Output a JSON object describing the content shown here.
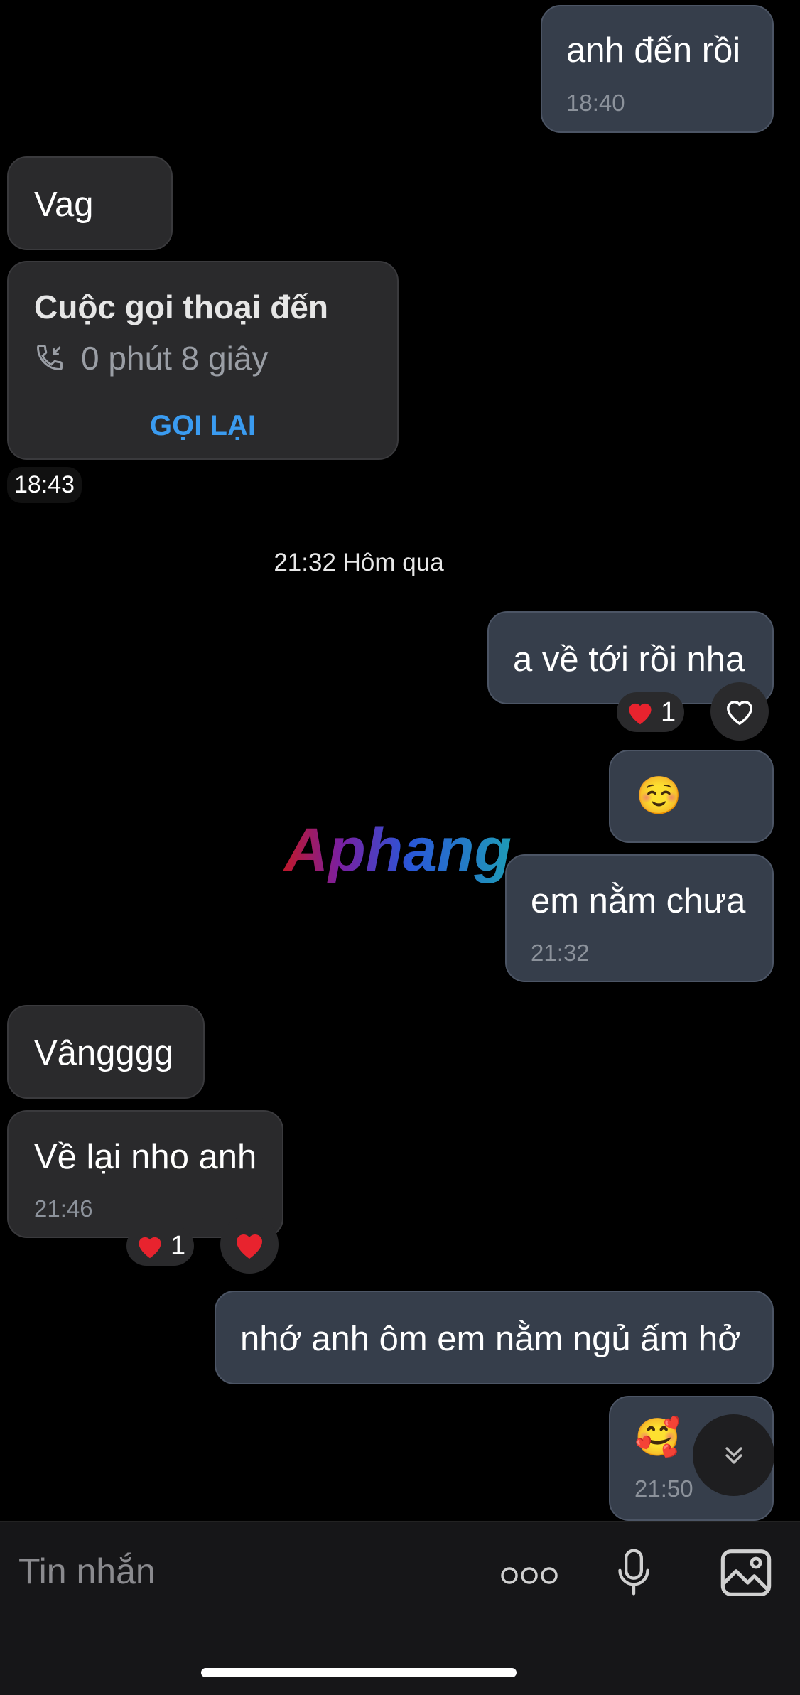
{
  "messages": {
    "m1": {
      "text": "anh đến rồi",
      "time": "18:40"
    },
    "m2": {
      "text": "Vag"
    },
    "call": {
      "title": "Cuộc gọi thoại đến",
      "duration": "0 phút 8 giây",
      "action": "GỌI LẠI"
    },
    "call_time": "18:43",
    "date_separator": "21:32 Hôm qua",
    "m3": {
      "text": "a về tới rồi nha",
      "reaction_count": "1"
    },
    "m4": {
      "emoji": "☺️"
    },
    "m5": {
      "text": "em nằm chưa",
      "time": "21:32"
    },
    "m6": {
      "text": "Vângggg"
    },
    "m7": {
      "text": "Về lại nho anh",
      "time": "21:46",
      "reaction_count": "1"
    },
    "m8": {
      "text": "nhớ anh ôm em nằm ngủ ấm hở"
    },
    "m9": {
      "emoji": "🥰",
      "time": "21:50"
    }
  },
  "watermark": {
    "text": "Aphang"
  },
  "composer": {
    "placeholder": "Tin nhắn"
  },
  "icons": [
    "heart-outline-icon",
    "heart-filled-icon",
    "phone-incoming-icon",
    "chevron-double-down-icon",
    "more-dots-icon",
    "microphone-icon",
    "image-icon"
  ],
  "colors": {
    "accent": "#3a9bf0",
    "incoming_bubble": "#2a2a2c",
    "outgoing_bubble": "#363e4b",
    "heart": "#e8232e"
  }
}
